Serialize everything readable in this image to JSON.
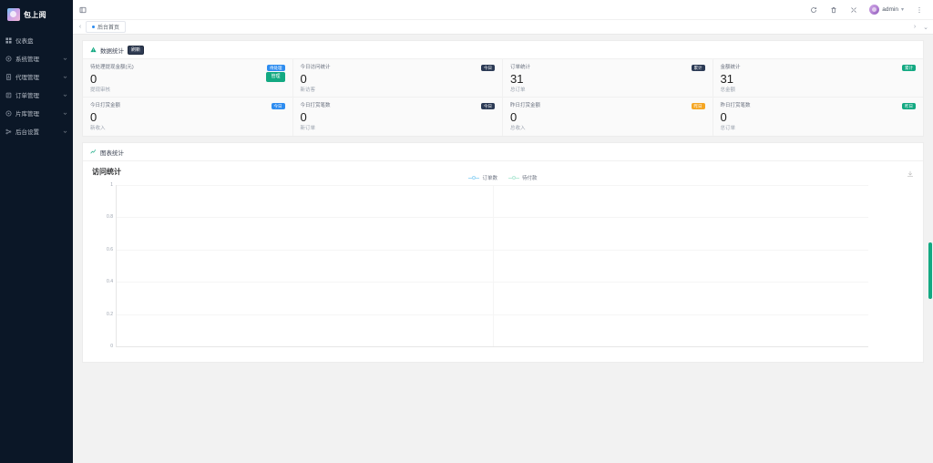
{
  "sidebar": {
    "brand": "包上阅",
    "items": [
      {
        "label": "仪表盘",
        "icon": "dashboard-icon",
        "expandable": false
      },
      {
        "label": "系统管理",
        "icon": "settings-icon",
        "expandable": true
      },
      {
        "label": "代理管理",
        "icon": "agent-icon",
        "expandable": true
      },
      {
        "label": "订单管理",
        "icon": "order-icon",
        "expandable": true
      },
      {
        "label": "片库管理",
        "icon": "video-library-icon",
        "expandable": true
      },
      {
        "label": "后台设置",
        "icon": "config-icon",
        "expandable": true
      }
    ]
  },
  "topbar": {
    "menu_icon": "menu-icon",
    "refresh_icon": "refresh-icon",
    "clear_icon": "clear-cache-icon",
    "fullscreen_icon": "fullscreen-icon",
    "user_name": "admin",
    "user_caret": "▾",
    "more_icon": "more-vertical-icon"
  },
  "tabbar": {
    "prev_arrow": "‹",
    "next_arrow": "›",
    "dropdown_arrow": "⌄",
    "tabs": [
      {
        "label": "后台首页",
        "active": true
      }
    ]
  },
  "stats_panel": {
    "title": "数据统计",
    "badge": "刷新",
    "icon": "warning-icon",
    "cards": [
      {
        "title": "待处理提现金额(元)",
        "value": "0",
        "sub": "提现审核",
        "badge": "待处理",
        "badge_color": "#2d8cf0",
        "action": "管理",
        "action_color": "#13a982"
      },
      {
        "title": "今日访问统计",
        "value": "0",
        "sub": "新访客",
        "badge": "今日",
        "badge_color": "#2b3a55"
      },
      {
        "title": "订单统计",
        "value": "31",
        "sub": "总订单",
        "badge": "累计",
        "badge_color": "#2b3a55"
      },
      {
        "title": "金额统计",
        "value": "31",
        "sub": "总金额",
        "badge": "累计",
        "badge_color": "#13a982"
      },
      {
        "title": "今日打赏金额",
        "value": "0",
        "sub": "新收入",
        "badge": "今日",
        "badge_color": "#2d8cf0"
      },
      {
        "title": "今日打赏笔数",
        "value": "0",
        "sub": "新订单",
        "badge": "今日",
        "badge_color": "#2b3a55"
      },
      {
        "title": "昨日打赏金额",
        "value": "0",
        "sub": "总收入",
        "badge": "昨日",
        "badge_color": "#f5a623"
      },
      {
        "title": "昨日打赏笔数",
        "value": "0",
        "sub": "总订单",
        "badge": "昨日",
        "badge_color": "#13a982"
      }
    ]
  },
  "chart_panel": {
    "header_title": "图表统计",
    "header_icon": "chart-line-icon",
    "save_icon": "save-image-icon"
  },
  "chart_data": {
    "type": "line",
    "title": "访问统计",
    "xlabel": "",
    "ylabel": "",
    "ylim": [
      0,
      1
    ],
    "yticks": [
      "0",
      "0.2",
      "0.4",
      "0.6",
      "0.8",
      "1"
    ],
    "x": [],
    "grid": true,
    "legend_position": "top-center",
    "legend": [
      "订单数",
      "待付款"
    ],
    "series": [
      {
        "name": "订单数",
        "values": [],
        "color": "#9fd8f5"
      },
      {
        "name": "待付款",
        "values": [],
        "color": "#b8ead8"
      }
    ]
  }
}
